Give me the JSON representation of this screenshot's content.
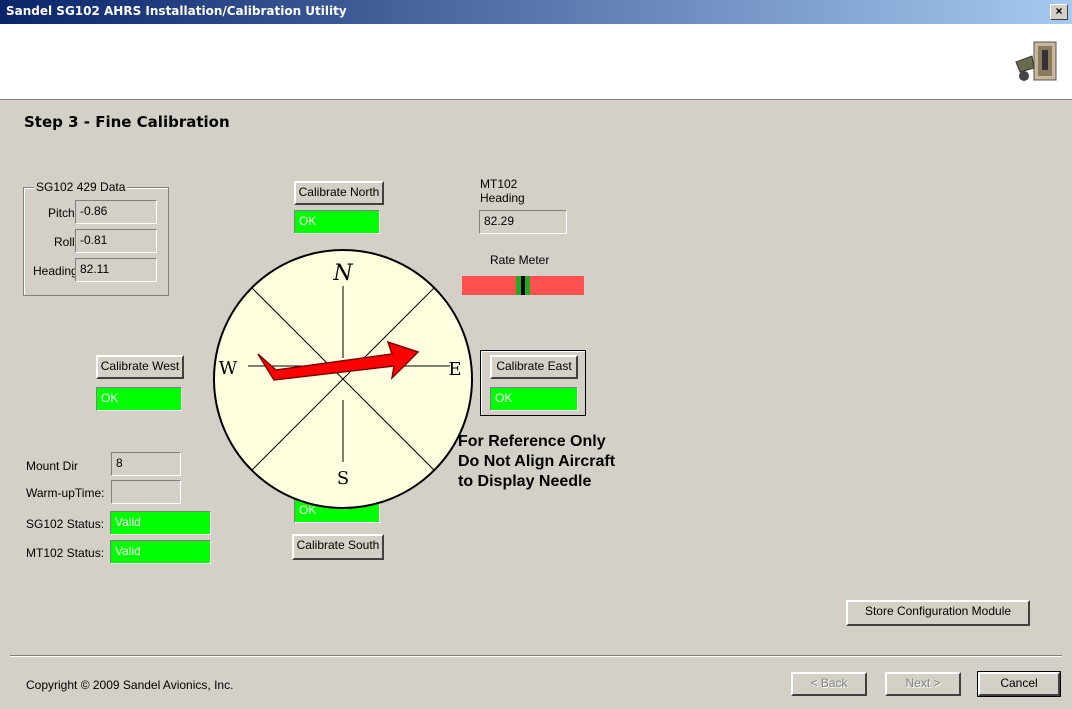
{
  "window": {
    "title": "Sandel SG102 AHRS Installation/Calibration Utility",
    "close_glyph": "×"
  },
  "step_title": "Step 3 - Fine Calibration",
  "sg102_data": {
    "legend": "SG102 429 Data",
    "pitch_label": "Pitch:",
    "pitch_value": "-0.86",
    "roll_label": "Roll:",
    "roll_value": "-0.81",
    "heading_label": "Heading:",
    "heading_value": "82.11"
  },
  "mt102": {
    "label_line1": "MT102",
    "label_line2": "Heading",
    "value": "82.29"
  },
  "rate_meter": {
    "label": "Rate Meter"
  },
  "calibrate": {
    "north": {
      "button": "Calibrate North",
      "status": "OK"
    },
    "west": {
      "button": "Calibrate West",
      "status": "OK"
    },
    "east": {
      "button": "Calibrate East",
      "status": "OK"
    },
    "south": {
      "button": "Calibrate South",
      "status": "OK"
    }
  },
  "compass": {
    "n": "N",
    "s": "S",
    "e": "E",
    "w": "W",
    "heading_deg": 82.29
  },
  "reference_note": {
    "line1": "For Reference Only",
    "line2": "Do Not Align Aircraft",
    "line3": "to Display Needle"
  },
  "status": {
    "mount_dir_label": "Mount Dir",
    "mount_dir_value": "8",
    "warmup_label": "Warm-upTime:",
    "warmup_value": "",
    "sg102_label": "SG102 Status:",
    "sg102_value": "Valid",
    "mt102_label": "MT102 Status:",
    "mt102_value": "Valid"
  },
  "buttons": {
    "store": "Store Configuration Module",
    "back": "< Back",
    "next": "Next >",
    "cancel": "Cancel"
  },
  "copyright": "Copyright © 2009 Sandel Avionics, Inc.",
  "colors": {
    "ok_green": "#00ff00",
    "arrow_red": "#ff0000",
    "compass_face": "#ffffe0",
    "rate_red": "#ff5050"
  }
}
